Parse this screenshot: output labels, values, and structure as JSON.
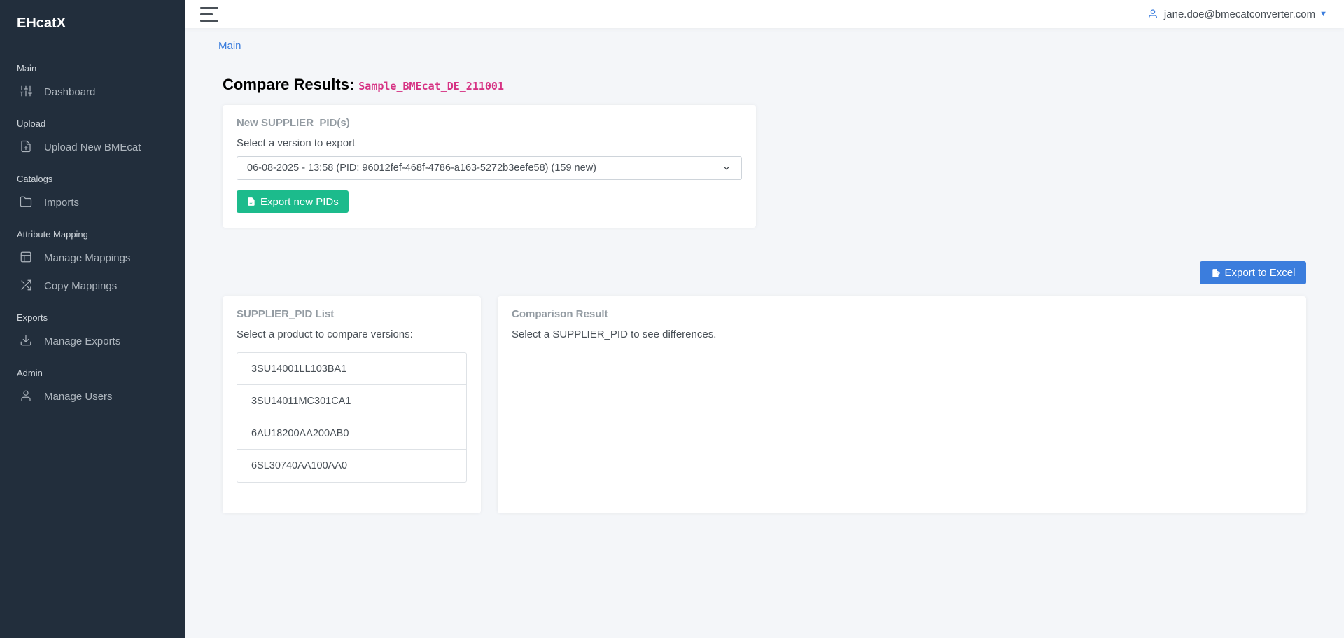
{
  "app": {
    "brand": "EHcatX"
  },
  "sidebar": {
    "sections": [
      {
        "header": "Main",
        "items": [
          {
            "label": "Dashboard",
            "icon": "sliders-icon"
          }
        ]
      },
      {
        "header": "Upload",
        "items": [
          {
            "label": "Upload New BMEcat",
            "icon": "file-plus-icon"
          }
        ]
      },
      {
        "header": "Catalogs",
        "items": [
          {
            "label": "Imports",
            "icon": "folder-icon"
          }
        ]
      },
      {
        "header": "Attribute Mapping",
        "items": [
          {
            "label": "Manage Mappings",
            "icon": "layout-icon"
          },
          {
            "label": "Copy Mappings",
            "icon": "shuffle-icon"
          }
        ]
      },
      {
        "header": "Exports",
        "items": [
          {
            "label": "Manage Exports",
            "icon": "download-icon"
          }
        ]
      },
      {
        "header": "Admin",
        "items": [
          {
            "label": "Manage Users",
            "icon": "user-icon"
          }
        ]
      }
    ]
  },
  "topbar": {
    "user_email": "jane.doe@bmecatconverter.com"
  },
  "breadcrumb": {
    "label": "Main"
  },
  "page": {
    "title": "Compare Results:",
    "file_name": "Sample_BMEcat_DE_211001"
  },
  "new_pids": {
    "title": "New SUPPLIER_PID(s)",
    "select_label": "Select a version to export",
    "selected_version": "06-08-2025 - 13:58 (PID: 96012fef-468f-4786-a163-5272b3eefe58) (159 new)",
    "export_button": "Export new PIDs"
  },
  "export_excel_button": "Export to Excel",
  "pid_list": {
    "title": "SUPPLIER_PID List",
    "subtitle": "Select a product to compare versions:",
    "items": [
      "3SU14001LL103BA1",
      "3SU14011MC301CA1",
      "6AU18200AA200AB0",
      "6SL30740AA100AA0"
    ]
  },
  "comparison": {
    "title": "Comparison Result",
    "hint": "Select a SUPPLIER_PID to see differences."
  },
  "colors": {
    "sidebar_bg": "#222e3c",
    "primary": "#3b7ddd",
    "success": "#1cbb8c",
    "code": "#d63384"
  }
}
